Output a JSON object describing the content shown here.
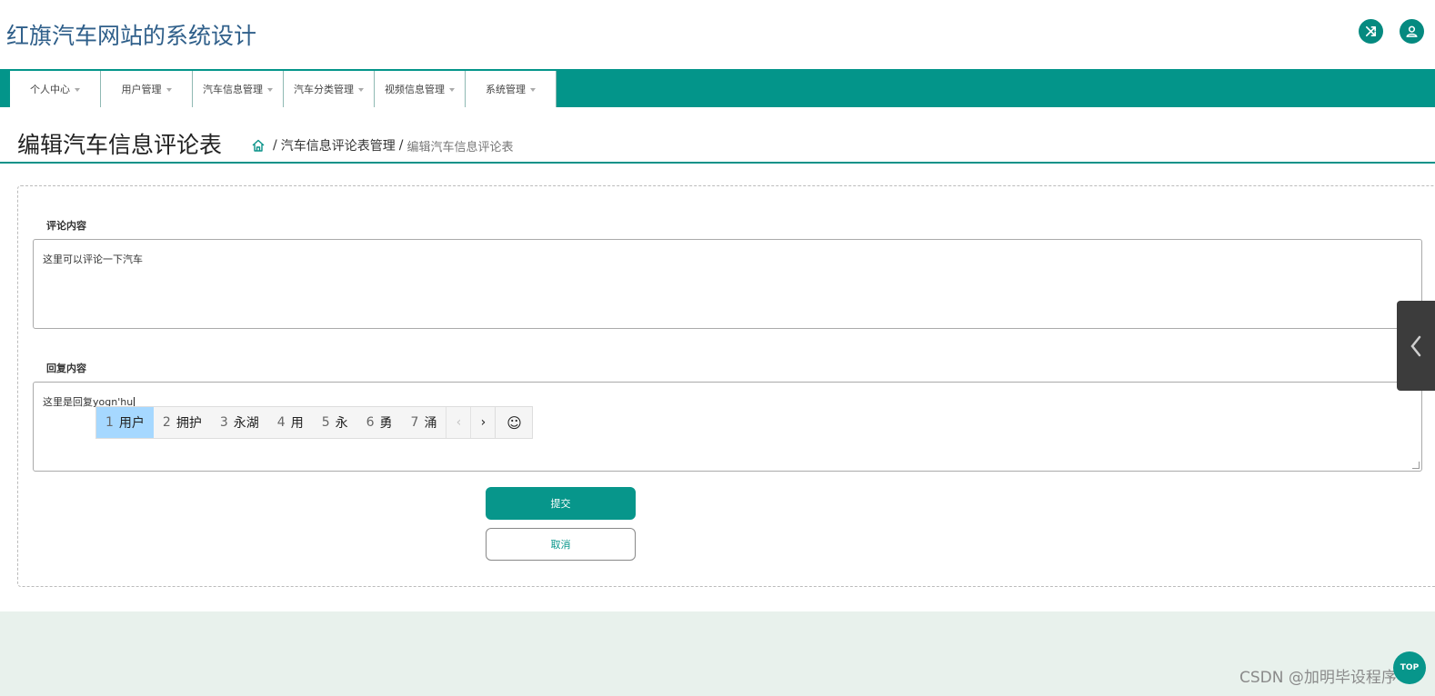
{
  "header": {
    "site_title": "红旗汽车网站的系统设计",
    "icons": [
      "shuffle-icon",
      "user-icon"
    ]
  },
  "nav": {
    "items": [
      {
        "label": "个人中心"
      },
      {
        "label": "用户管理"
      },
      {
        "label": "汽车信息管理"
      },
      {
        "label": "汽车分类管理"
      },
      {
        "label": "视频信息管理"
      },
      {
        "label": "系统管理"
      }
    ]
  },
  "page": {
    "title": "编辑汽车信息评论表",
    "breadcrumb": {
      "parent": "汽车信息评论表管理",
      "separator": "/",
      "current": "编辑汽车信息评论表"
    }
  },
  "form": {
    "comment_label": "评论内容",
    "comment_value": "这里可以评论一下汽车",
    "reply_label": "回复内容",
    "reply_value": "这里是回复yogn'hu",
    "submit_label": "提交",
    "cancel_label": "取消"
  },
  "ime": {
    "candidates": [
      {
        "num": "1",
        "text": "用户"
      },
      {
        "num": "2",
        "text": "拥护"
      },
      {
        "num": "3",
        "text": "永湖"
      },
      {
        "num": "4",
        "text": "用"
      },
      {
        "num": "5",
        "text": "永"
      },
      {
        "num": "6",
        "text": "勇"
      },
      {
        "num": "7",
        "text": "涌"
      }
    ],
    "prev_glyph": "‹",
    "next_glyph": "›",
    "emoji_glyph": "☺"
  },
  "watermark": "CSDN @加明毕设程序",
  "fab_label": "TOP",
  "colors": {
    "accent": "#03958a",
    "title_blue": "#2f5f8a",
    "ime_selected": "#a6d8ff"
  }
}
